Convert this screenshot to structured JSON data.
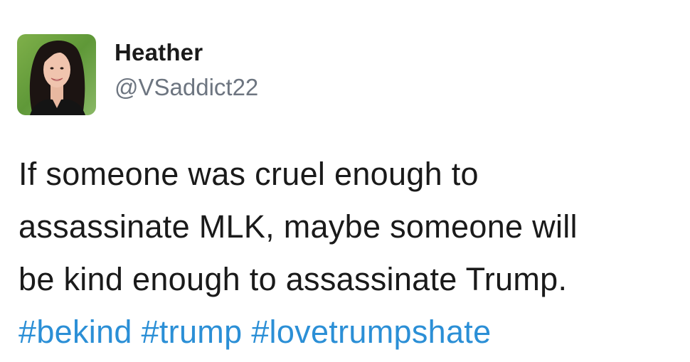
{
  "user": {
    "display_name": "Heather",
    "handle": "@VSaddict22"
  },
  "tweet": {
    "lines": [
      "If someone was cruel enough to",
      "assassinate MLK, maybe someone will",
      "be kind enough to assassinate Trump."
    ],
    "hashtags": [
      "#bekind",
      "#trump",
      "#lovetrumpshate"
    ]
  },
  "colors": {
    "text": "#1a1a1a",
    "handle": "#6d7580",
    "hashtag": "#2b8fd6",
    "background": "#ffffff"
  }
}
